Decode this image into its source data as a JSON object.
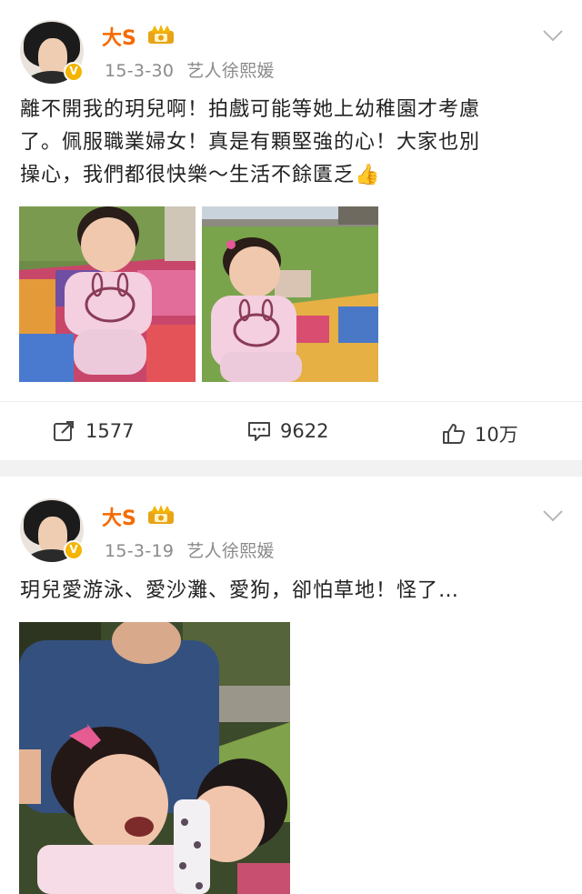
{
  "posts": [
    {
      "username": "大S",
      "date": "15-3-30",
      "source": "艺人徐熙媛",
      "text_lines": [
        "離不開我的玥兒啊！拍戲可能等她上幼稚園才考慮",
        "了。佩服職業婦女！真是有顆堅強的心！大家也別",
        "操心，我們都很快樂～生活不餘匱乏"
      ],
      "thumb_emoji": "👍",
      "actions": {
        "repost_count": "1577",
        "comment_count": "9622",
        "like_count": "10万"
      }
    },
    {
      "username": "大S",
      "date": "15-3-19",
      "source": "艺人徐熙媛",
      "text": "玥兒愛游泳、愛沙灘、愛狗，卻怕草地！怪了…"
    }
  ],
  "icons": {
    "verified_badge": "V",
    "member_crown": "crown-icon",
    "expand": "chevron-down-icon",
    "repost": "share-icon",
    "comment": "comment-icon",
    "like": "thumbs-up-icon"
  },
  "colors": {
    "username": "#f56a00",
    "meta": "#8a8a8a",
    "badge": "#f5b400",
    "divider": "#f2f2f2"
  }
}
